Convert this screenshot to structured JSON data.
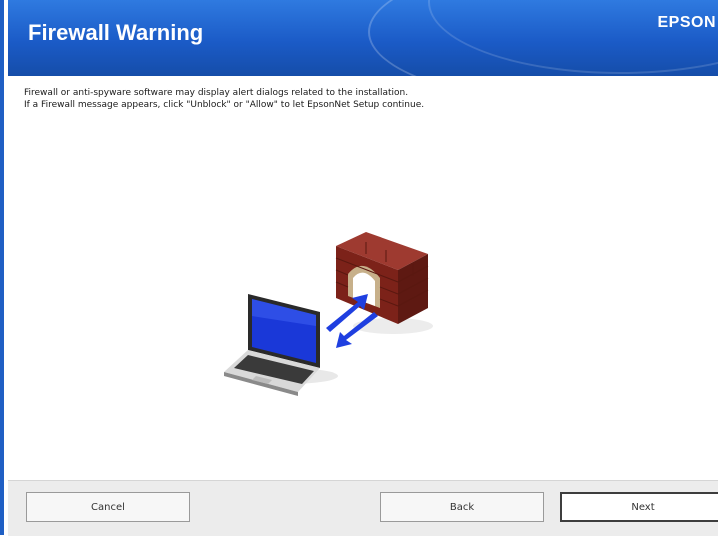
{
  "header": {
    "title": "Firewall Warning",
    "brand": "EPSON"
  },
  "content": {
    "line1": "Firewall or anti-spyware software may display alert dialogs related to the installation.",
    "line2": "If a Firewall message appears, click \"Unblock\" or \"Allow\" to let EpsonNet Setup continue."
  },
  "footer": {
    "cancel": "Cancel",
    "back": "Back",
    "next": "Next"
  },
  "colors": {
    "header_blue": "#1b5bc7",
    "arrow_blue": "#1f3fe0",
    "brick_red": "#8b2a22"
  },
  "icons": [
    "laptop-icon",
    "firewall-brick-wall-icon",
    "data-arrows-icon"
  ]
}
